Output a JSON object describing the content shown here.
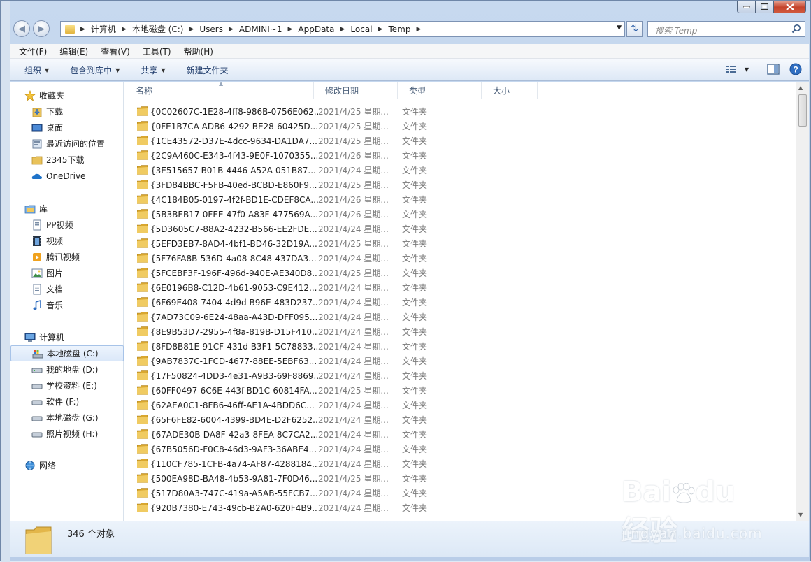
{
  "window": {
    "caption": {
      "min_label": "—",
      "max_label": "□",
      "close_label": "✕"
    }
  },
  "address": {
    "crumbs": [
      "计算机",
      "本地磁盘 (C:)",
      "Users",
      "ADMINI~1",
      "AppData",
      "Local",
      "Temp"
    ]
  },
  "search": {
    "placeholder": "搜索 Temp"
  },
  "menubar": [
    "文件(F)",
    "编辑(E)",
    "查看(V)",
    "工具(T)",
    "帮助(H)"
  ],
  "toolbar": {
    "organize": "组织",
    "include_in_library": "包含到库中",
    "share": "共享",
    "new_folder": "新建文件夹"
  },
  "navpane": {
    "favorites": {
      "label": "收藏夹",
      "items": [
        "下载",
        "桌面",
        "最近访问的位置",
        "2345下载",
        "OneDrive"
      ]
    },
    "libraries": {
      "label": "库",
      "items": [
        "PP视频",
        "视频",
        "腾讯视频",
        "图片",
        "文档",
        "音乐"
      ]
    },
    "computer": {
      "label": "计算机",
      "items": [
        "本地磁盘 (C:)",
        "我的地盘 (D:)",
        "学校资料 (E:)",
        "软件 (F:)",
        "本地磁盘 (G:)",
        "照片视频 (H:)"
      ],
      "selected": 0
    },
    "network": {
      "label": "网络"
    }
  },
  "columns": {
    "name": "名称",
    "modified": "修改日期",
    "type": "类型",
    "size": "大小"
  },
  "rows": [
    {
      "name": "{0C02607C-1E28-4ff8-986B-0756E062...",
      "date": "2021/4/25 星期...",
      "type": "文件夹"
    },
    {
      "name": "{0FE1B7CA-ADB6-4292-BE28-60425D...",
      "date": "2021/4/25 星期...",
      "type": "文件夹"
    },
    {
      "name": "{1CE43572-D37E-4dcc-9634-DA1DA7...",
      "date": "2021/4/25 星期...",
      "type": "文件夹"
    },
    {
      "name": "{2C9A460C-E343-4f43-9E0F-1070355...",
      "date": "2021/4/26 星期...",
      "type": "文件夹"
    },
    {
      "name": "{3E515657-B01B-4446-A52A-051B87...",
      "date": "2021/4/24 星期...",
      "type": "文件夹"
    },
    {
      "name": "{3FD84BBC-F5FB-40ed-BCBD-E860F9...",
      "date": "2021/4/25 星期...",
      "type": "文件夹"
    },
    {
      "name": "{4C184B05-0197-4f2f-BD1E-CDEF8CA...",
      "date": "2021/4/26 星期...",
      "type": "文件夹"
    },
    {
      "name": "{5B3BEB17-0FEE-47f0-A83F-477569A...",
      "date": "2021/4/26 星期...",
      "type": "文件夹"
    },
    {
      "name": "{5D3605C7-88A2-4232-B566-EE2FDE...",
      "date": "2021/4/24 星期...",
      "type": "文件夹"
    },
    {
      "name": "{5EFD3EB7-8AD4-4bf1-BD46-32D19A...",
      "date": "2021/4/25 星期...",
      "type": "文件夹"
    },
    {
      "name": "{5F76FA8B-536D-4a08-8C48-437DA3...",
      "date": "2021/4/24 星期...",
      "type": "文件夹"
    },
    {
      "name": "{5FCEBF3F-196F-496d-940E-AE340D8...",
      "date": "2021/4/25 星期...",
      "type": "文件夹"
    },
    {
      "name": "{6E0196B8-C12D-4b61-9053-C9E412...",
      "date": "2021/4/24 星期...",
      "type": "文件夹"
    },
    {
      "name": "{6F69E408-7404-4d9d-B96E-483D237...",
      "date": "2021/4/24 星期...",
      "type": "文件夹"
    },
    {
      "name": "{7AD73C09-6E24-48aa-A43D-DFF095...",
      "date": "2021/4/24 星期...",
      "type": "文件夹"
    },
    {
      "name": "{8E9B53D7-2955-4f8a-819B-D15F410...",
      "date": "2021/4/24 星期...",
      "type": "文件夹"
    },
    {
      "name": "{8FD8B81E-91CF-431d-B3F1-5C78833...",
      "date": "2021/4/24 星期...",
      "type": "文件夹"
    },
    {
      "name": "{9AB7837C-1FCD-4677-88EE-5EBF63...",
      "date": "2021/4/24 星期...",
      "type": "文件夹"
    },
    {
      "name": "{17F50824-4DD3-4e31-A9B3-69F8869...",
      "date": "2021/4/24 星期...",
      "type": "文件夹"
    },
    {
      "name": "{60FF0497-6C6E-443f-BD1C-60814FA...",
      "date": "2021/4/25 星期...",
      "type": "文件夹"
    },
    {
      "name": "{62AEA0C1-8FB6-46ff-AE1A-4BDD6C...",
      "date": "2021/4/24 星期...",
      "type": "文件夹"
    },
    {
      "name": "{65F6FE82-6004-4399-BD4E-D2F6252...",
      "date": "2021/4/24 星期...",
      "type": "文件夹"
    },
    {
      "name": "{67ADE30B-DA8F-42a3-8FEA-8C7CA2...",
      "date": "2021/4/24 星期...",
      "type": "文件夹"
    },
    {
      "name": "{67B5056D-F0C8-46d3-9AF3-36ABE4...",
      "date": "2021/4/24 星期...",
      "type": "文件夹"
    },
    {
      "name": "{110CF785-1CFB-4a74-AF87-4288184...",
      "date": "2021/4/24 星期...",
      "type": "文件夹"
    },
    {
      "name": "{500EA98D-BA48-4b53-9A81-7F0D46...",
      "date": "2021/4/25 星期...",
      "type": "文件夹"
    },
    {
      "name": "{517D80A3-747C-419a-A5AB-55FCB7...",
      "date": "2021/4/24 星期...",
      "type": "文件夹"
    },
    {
      "name": "{920B7380-E743-49cb-B2A0-620F4B9...",
      "date": "2021/4/24 星期...",
      "type": "文件夹"
    }
  ],
  "status": {
    "count_text": "346 个对象"
  },
  "watermark": {
    "logo": "Bai du 经验",
    "url": "jingyan.baidu.com"
  },
  "colors": {
    "accent": "#1e3b6b",
    "folder": "#e7be4c",
    "selection": "#dbe8f9"
  }
}
